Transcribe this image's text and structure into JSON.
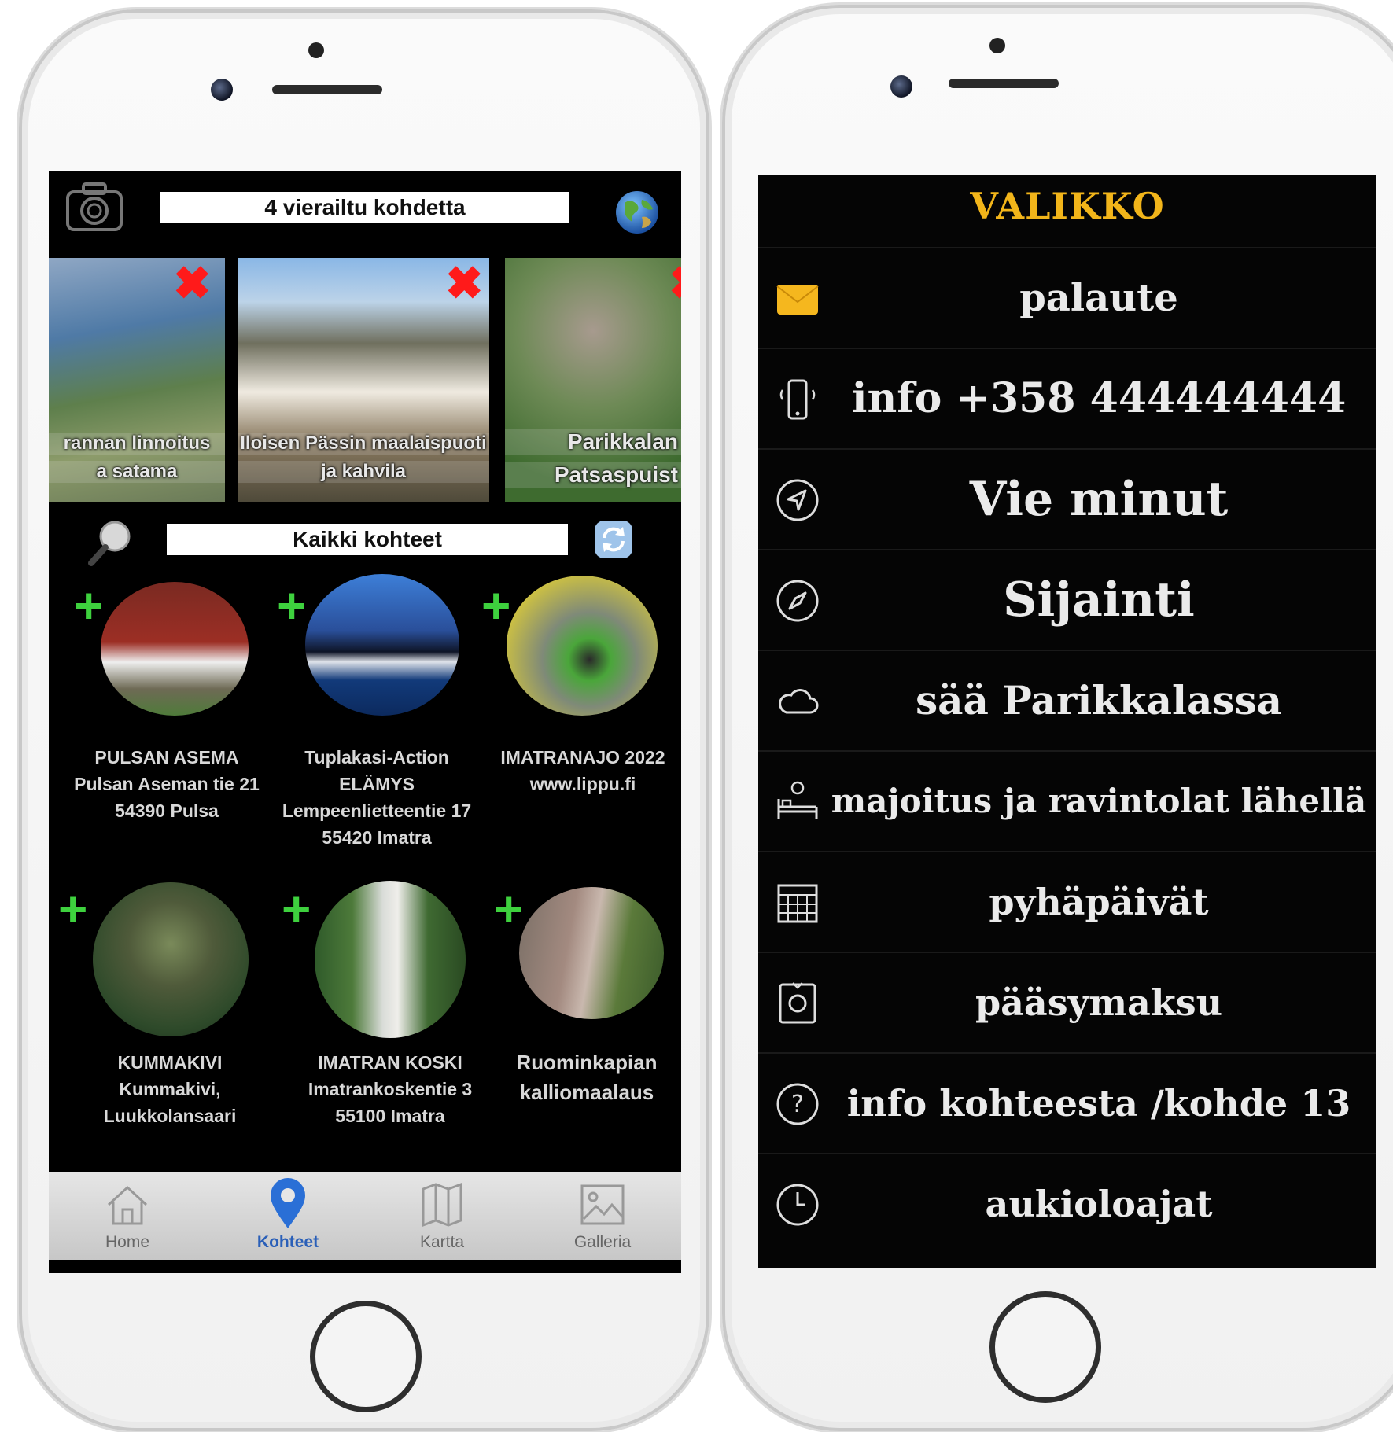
{
  "left_phone": {
    "visited_title": "4 vierailtu kohdetta",
    "visited": [
      {
        "caption_line1": "rannan linnoitus",
        "caption_line2": "a satama"
      },
      {
        "caption_line1": "Iloisen Pässin maalaispuoti",
        "caption_line2": "ja kahvila"
      },
      {
        "caption_line1": "Parikkalan",
        "caption_line2": "Patsaspuist"
      }
    ],
    "all_title": "Kaikki kohteet",
    "places": [
      {
        "l1": "PULSAN ASEMA",
        "l2": "Pulsan Aseman tie 21",
        "l3": "54390 Pulsa"
      },
      {
        "l1": "Tuplakasi-Action ELÄMYS",
        "l2": "Lempeenlietteentie 17",
        "l3": "55420 Imatra"
      },
      {
        "l1": "IMATRANAJO 2022",
        "l2": "www.lippu.fi",
        "l3": ""
      },
      {
        "l1": "KUMMAKIVI",
        "l2": "Kummakivi, Luukkolansaari",
        "l3": ""
      },
      {
        "l1": "IMATRAN KOSKI",
        "l2": "Imatrankoskentie 3",
        "l3": "55100 Imatra"
      },
      {
        "l1": "Ruominkapian",
        "l2": "kalliomaalaus",
        "l3": ""
      }
    ],
    "tabs": [
      {
        "label": "Home",
        "icon": "home-icon"
      },
      {
        "label": "Kohteet",
        "icon": "location-pin-icon"
      },
      {
        "label": "Kartta",
        "icon": "map-icon"
      },
      {
        "label": "Galleria",
        "icon": "image-icon"
      }
    ],
    "active_tab": "Kohteet",
    "accent_color": "#2a6fd6",
    "add_color": "#3ed13e",
    "remove_color": "#ff1a1a"
  },
  "right_phone": {
    "menu_title": "VALIKKO",
    "title_color": "#f2b51a",
    "items": [
      {
        "label": "palaute",
        "icon": "envelope-icon"
      },
      {
        "label": "info +358 444444444",
        "icon": "phone-icon"
      },
      {
        "label": "Vie  minut",
        "icon": "navigation-icon"
      },
      {
        "label": "Sijainti",
        "icon": "compass-icon"
      },
      {
        "label": "sää Parikkalassa",
        "icon": "cloud-icon"
      },
      {
        "label": "majoitus ja ravintolat lähellä",
        "icon": "bed-icon"
      },
      {
        "label": "pyhäpäivät",
        "icon": "calendar-icon"
      },
      {
        "label": "pääsymaksu",
        "icon": "ticket-icon"
      },
      {
        "label": "info kohteesta /kohde 13",
        "icon": "question-icon"
      },
      {
        "label": "aukioloajat",
        "icon": "clock-icon"
      }
    ]
  }
}
